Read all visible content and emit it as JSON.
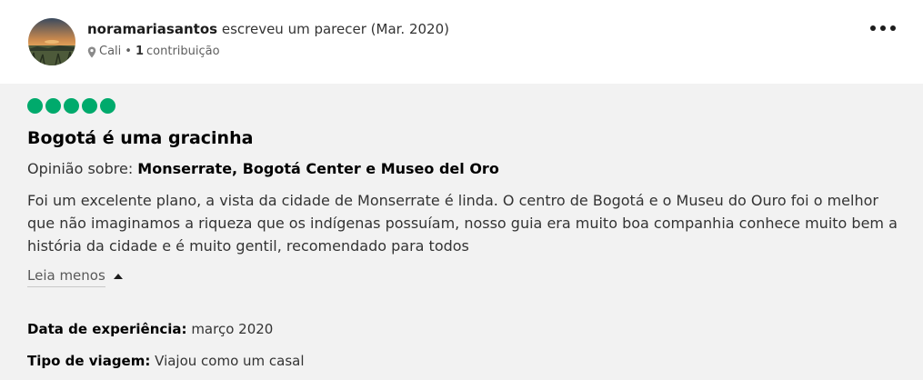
{
  "review": {
    "author": {
      "username": "noramariasantos",
      "action": "escreveu um parecer (Mar. 2020)",
      "location": "Cali",
      "separator": "•",
      "contrib_count": "1",
      "contrib_label": "contribuição",
      "avatar_icon": "sunset-landscape-avatar"
    },
    "more_icon": "more-horizontal-icon",
    "rating": {
      "value": 5,
      "max": 5,
      "color": "#00aa6c"
    },
    "title": "Bogotá é uma gracinha",
    "subject_prefix": "Opinião sobre:",
    "subject_name": "Monserrate, Bogotá Center e Museo del Oro",
    "text": "Foi um excelente plano, a vista da cidade de Monserrate é linda. O centro de Bogotá e o Museu do Ouro foi o melhor que não imaginamos a riqueza que os indígenas possuíam, nosso guia era muito boa companhia conhece muito bem a história da cidade e é muito gentil, recomendado para todos",
    "read_less_label": "Leia menos",
    "details": {
      "experience_label": "Data de experiência:",
      "experience_value": "março 2020",
      "trip_type_label": "Tipo de viagem:",
      "trip_type_value": "Viajou como um casal"
    }
  },
  "colors": {
    "body_background": "#f2f2f2",
    "accent_green": "#00aa6c"
  }
}
